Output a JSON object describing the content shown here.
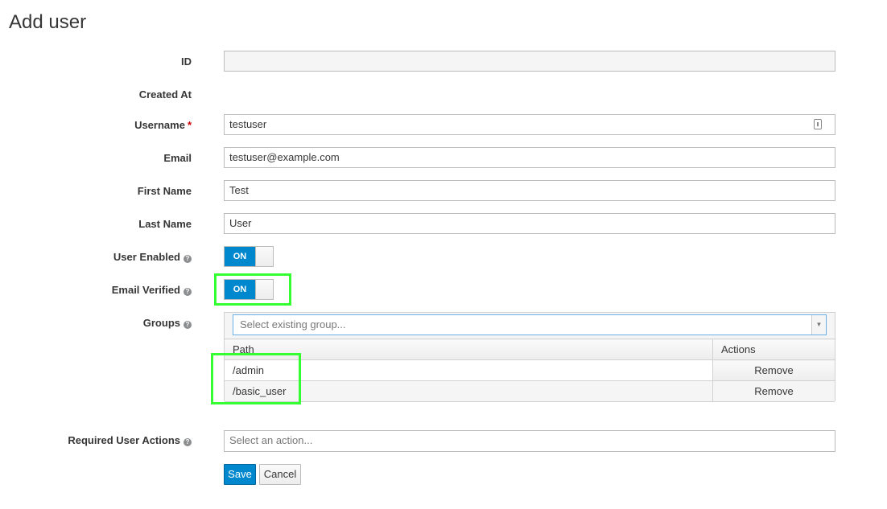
{
  "page": {
    "title": "Add user"
  },
  "form": {
    "id": {
      "label": "ID",
      "value": ""
    },
    "created_at": {
      "label": "Created At",
      "value": ""
    },
    "username": {
      "label": "Username",
      "required_mark": "*",
      "value": "testuser"
    },
    "email": {
      "label": "Email",
      "value": "testuser@example.com"
    },
    "first_name": {
      "label": "First Name",
      "value": "Test"
    },
    "last_name": {
      "label": "Last Name",
      "value": "User"
    },
    "user_enabled": {
      "label": "User Enabled",
      "state": "ON"
    },
    "email_verified": {
      "label": "Email Verified",
      "state": "ON"
    },
    "groups": {
      "label": "Groups",
      "placeholder": "Select existing group...",
      "columns": [
        "Path",
        "Actions"
      ],
      "rows": [
        {
          "path": "/admin",
          "action": "Remove"
        },
        {
          "path": "/basic_user",
          "action": "Remove"
        }
      ]
    },
    "required_actions": {
      "label": "Required User Actions",
      "placeholder": "Select an action..."
    }
  },
  "buttons": {
    "save": "Save",
    "cancel": "Cancel"
  },
  "icons": {
    "help": "question-circle-icon",
    "keyboard": "keyboard-icon",
    "caret": "caret-down-icon"
  },
  "colors": {
    "accent": "#0088ce",
    "highlight": "#33ff33",
    "required": "#cc0000"
  }
}
